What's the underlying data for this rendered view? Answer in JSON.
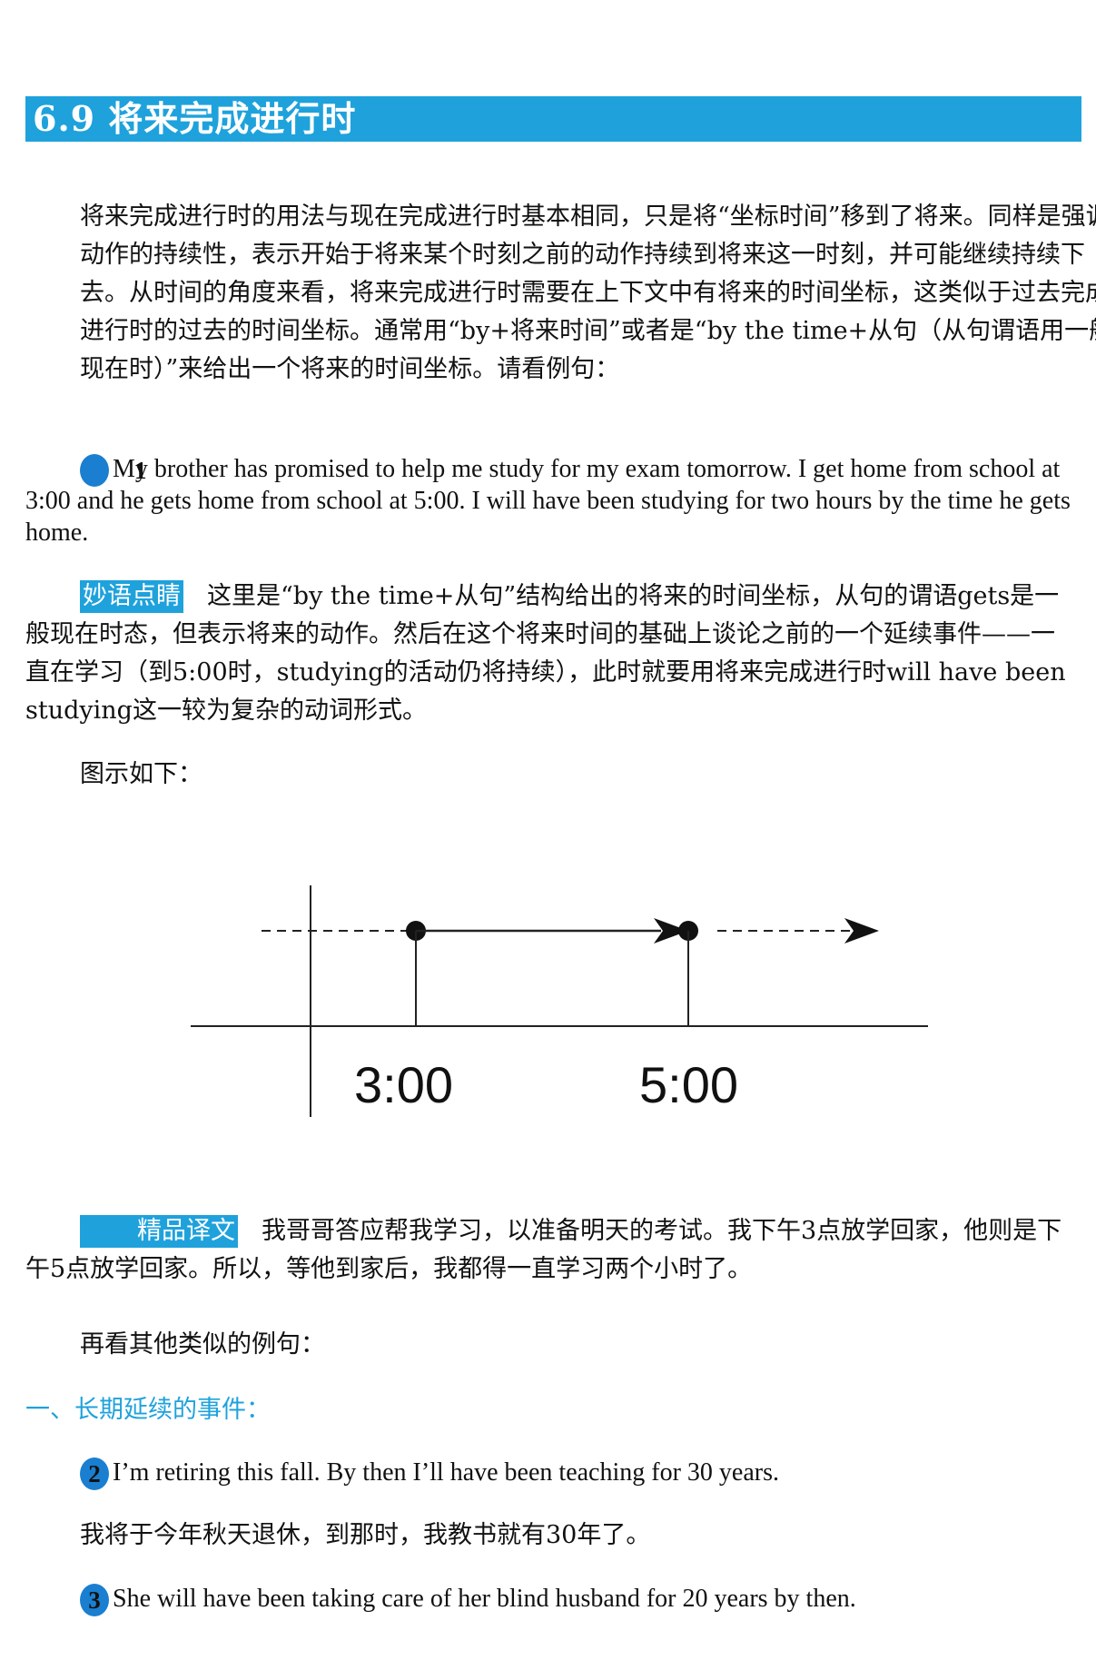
{
  "section": {
    "title": "6.9 将来完成进行时"
  },
  "intro": "将来完成进行时的用法与现在完成进行时基本相同，只是将“坐标时间”移到了将来。同样是强调动作的持续性，表示开始于将来某个时刻之前的动作持续到将来这一时刻，并可能继续持续下去。从时间的角度来看，将来完成进行时需要在上下文中有将来的时间坐标，这类似于过去完成进行时的过去的时间坐标。通常用“by+将来时间”或者是“by the time+从句（从句谓语用一般现在时）”来给出一个将来的时间坐标。请看例句：",
  "example1": {
    "num": "1",
    "text": "My brother has promised to help me study for my exam tomorrow. I get home from school at 3:00 and he gets home from school at 5:00. I will have been studying for two hours by the time he gets home."
  },
  "note": {
    "tag": "妙语点睛",
    "text": "这里是“by the time+从句”结构给出的将来的时间坐标，从句的谓语gets是一般现在时态，但表示将来的动作。然后在这个将来时间的基础上谈论之前的一个延续事件——一直在学习（到5:00时，studying的活动仍将持续），此时就要用将来完成进行时will have been studying这一较为复杂的动词形式。"
  },
  "diagram_caption": "图示如下：",
  "timeline": {
    "labels": [
      "3:00",
      "5:00"
    ]
  },
  "translation": {
    "tag": "精品译文",
    "text": "我哥哥答应帮我学习，以准备明天的考试。我下午3点放学回家，他则是下午5点放学回家。所以，等他到家后，我都得一直学习两个小时了。"
  },
  "more_examples_intro": "再看其他类似的例句：",
  "subheading": "一、长期延续的事件：",
  "example2": {
    "num": "2",
    "text": "I’m retiring this fall. By then I’ll have been teaching for 30 years.",
    "translation": "我将于今年秋天退休，到那时，我教书就有30年了。"
  },
  "example3": {
    "num": "3",
    "text": "She will have been taking care of her blind husband for 20 years by then."
  }
}
